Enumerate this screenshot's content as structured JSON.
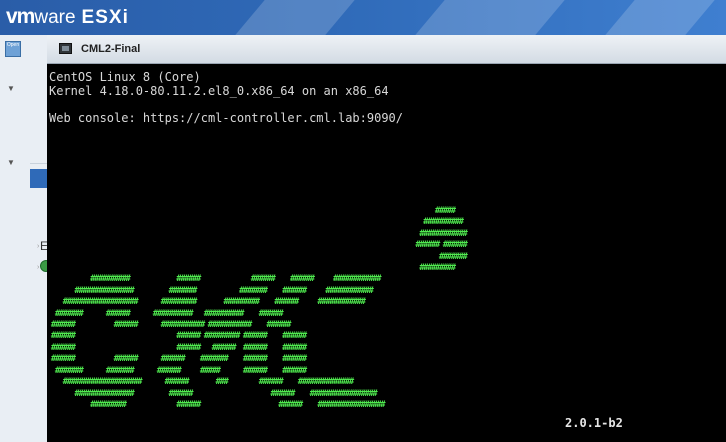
{
  "brand": {
    "vm": "vm",
    "ware": "ware",
    "product": "ESXi"
  },
  "window": {
    "title": "CML2-Final"
  },
  "left_panel": {
    "open_label": "Open",
    "tree_letter": "E"
  },
  "console": {
    "lines": [
      "CentOS Linux 8 (Core)",
      "Kernel 4.18.0-80.11.2.el8_0.x86_64 on an x86_64",
      "Web console: https://cml-controller.cml.lab:9090/"
    ],
    "version": "2.0.1-b2",
    "text_color": "#d8d8d8",
    "art_color": "#4fea4f"
  }
}
